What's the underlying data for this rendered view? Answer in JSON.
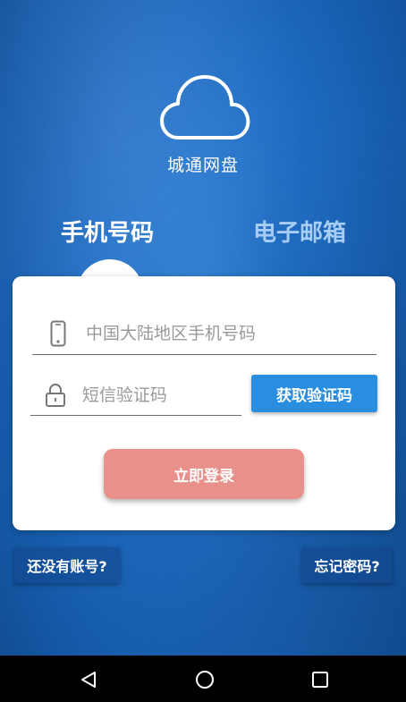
{
  "app": {
    "name": "城通网盘"
  },
  "tabs": [
    {
      "label": "手机号码",
      "active": true
    },
    {
      "label": "电子邮箱",
      "active": false
    }
  ],
  "form": {
    "phone_placeholder": "中国大陆地区手机号码",
    "code_placeholder": "短信验证码",
    "get_code_label": "获取验证码",
    "login_label": "立即登录"
  },
  "links": {
    "register_label": "还没有账号?",
    "forgot_label": "忘记密码?"
  },
  "icons": {
    "logo": "cloud-icon",
    "phone": "phone-icon",
    "code": "lock-icon",
    "nav": [
      "back-icon",
      "home-icon",
      "recent-apps-icon"
    ]
  },
  "colors": {
    "background": "#1f6cc4",
    "get_code_button": "#2a8ee0",
    "login_button": "#e8918a",
    "active_tab": "#ffffff",
    "inactive_tab": "#a8cdf5"
  }
}
